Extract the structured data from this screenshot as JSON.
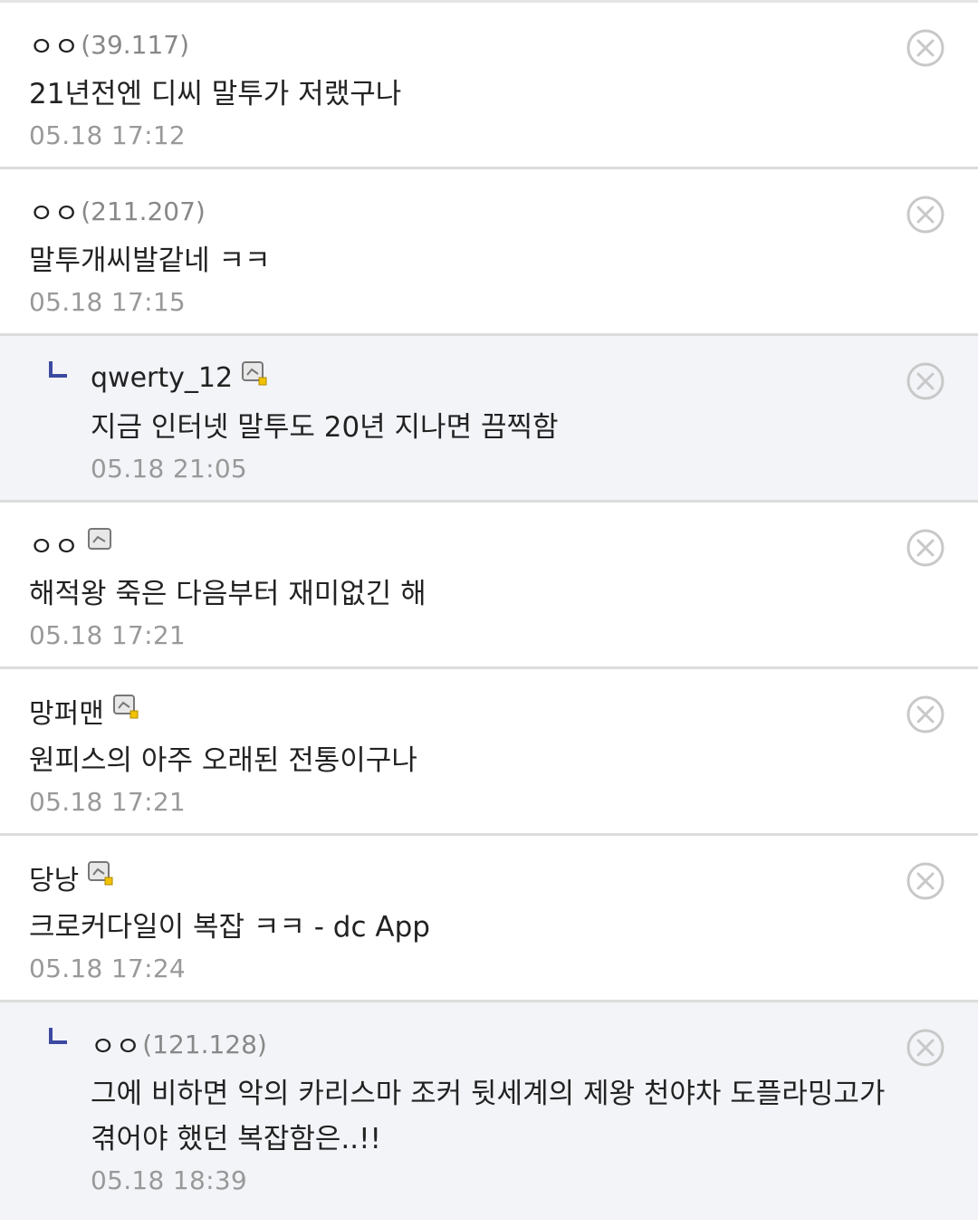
{
  "comments": [
    {
      "nick": "ㅇㅇ",
      "ip": "(39.117)",
      "text": "21년전엔 디씨 말투가 저랬구나",
      "time": "05.18 17:12",
      "reply": false,
      "icon": ""
    },
    {
      "nick": "ㅇㅇ",
      "ip": "(211.207)",
      "text": "말투개씨발같네 ㅋㅋ",
      "time": "05.18 17:15",
      "reply": false,
      "icon": ""
    },
    {
      "nick": "qwerty_12",
      "ip": "",
      "text": "지금 인터넷 말투도 20년 지나면 끔찍함",
      "time": "05.18 21:05",
      "reply": true,
      "icon": "fixed-nick-icon"
    },
    {
      "nick": "ㅇㅇ",
      "ip": "",
      "text": "해적왕 죽은 다음부터 재미없긴 해",
      "time": "05.18 17:21",
      "reply": false,
      "icon": "gonik-icon"
    },
    {
      "nick": "망퍼맨",
      "ip": "",
      "text": "원피스의 아주 오래된 전통이구나",
      "time": "05.18 17:21",
      "reply": false,
      "icon": "fixed-nick-icon"
    },
    {
      "nick": "당낭",
      "ip": "",
      "text": "크로커다일이 복잡 ㅋㅋ - dc App",
      "time": "05.18 17:24",
      "reply": false,
      "icon": "fixed-nick-icon"
    },
    {
      "nick": "ㅇㅇ",
      "ip": "(121.128)",
      "text": "그에 비하면 악의 카리스마 조커 뒷세계의 제왕 천야차 도플라밍고가 겪어야 했던 복잡함은..!!",
      "time": "05.18 18:39",
      "reply": true,
      "icon": ""
    }
  ]
}
